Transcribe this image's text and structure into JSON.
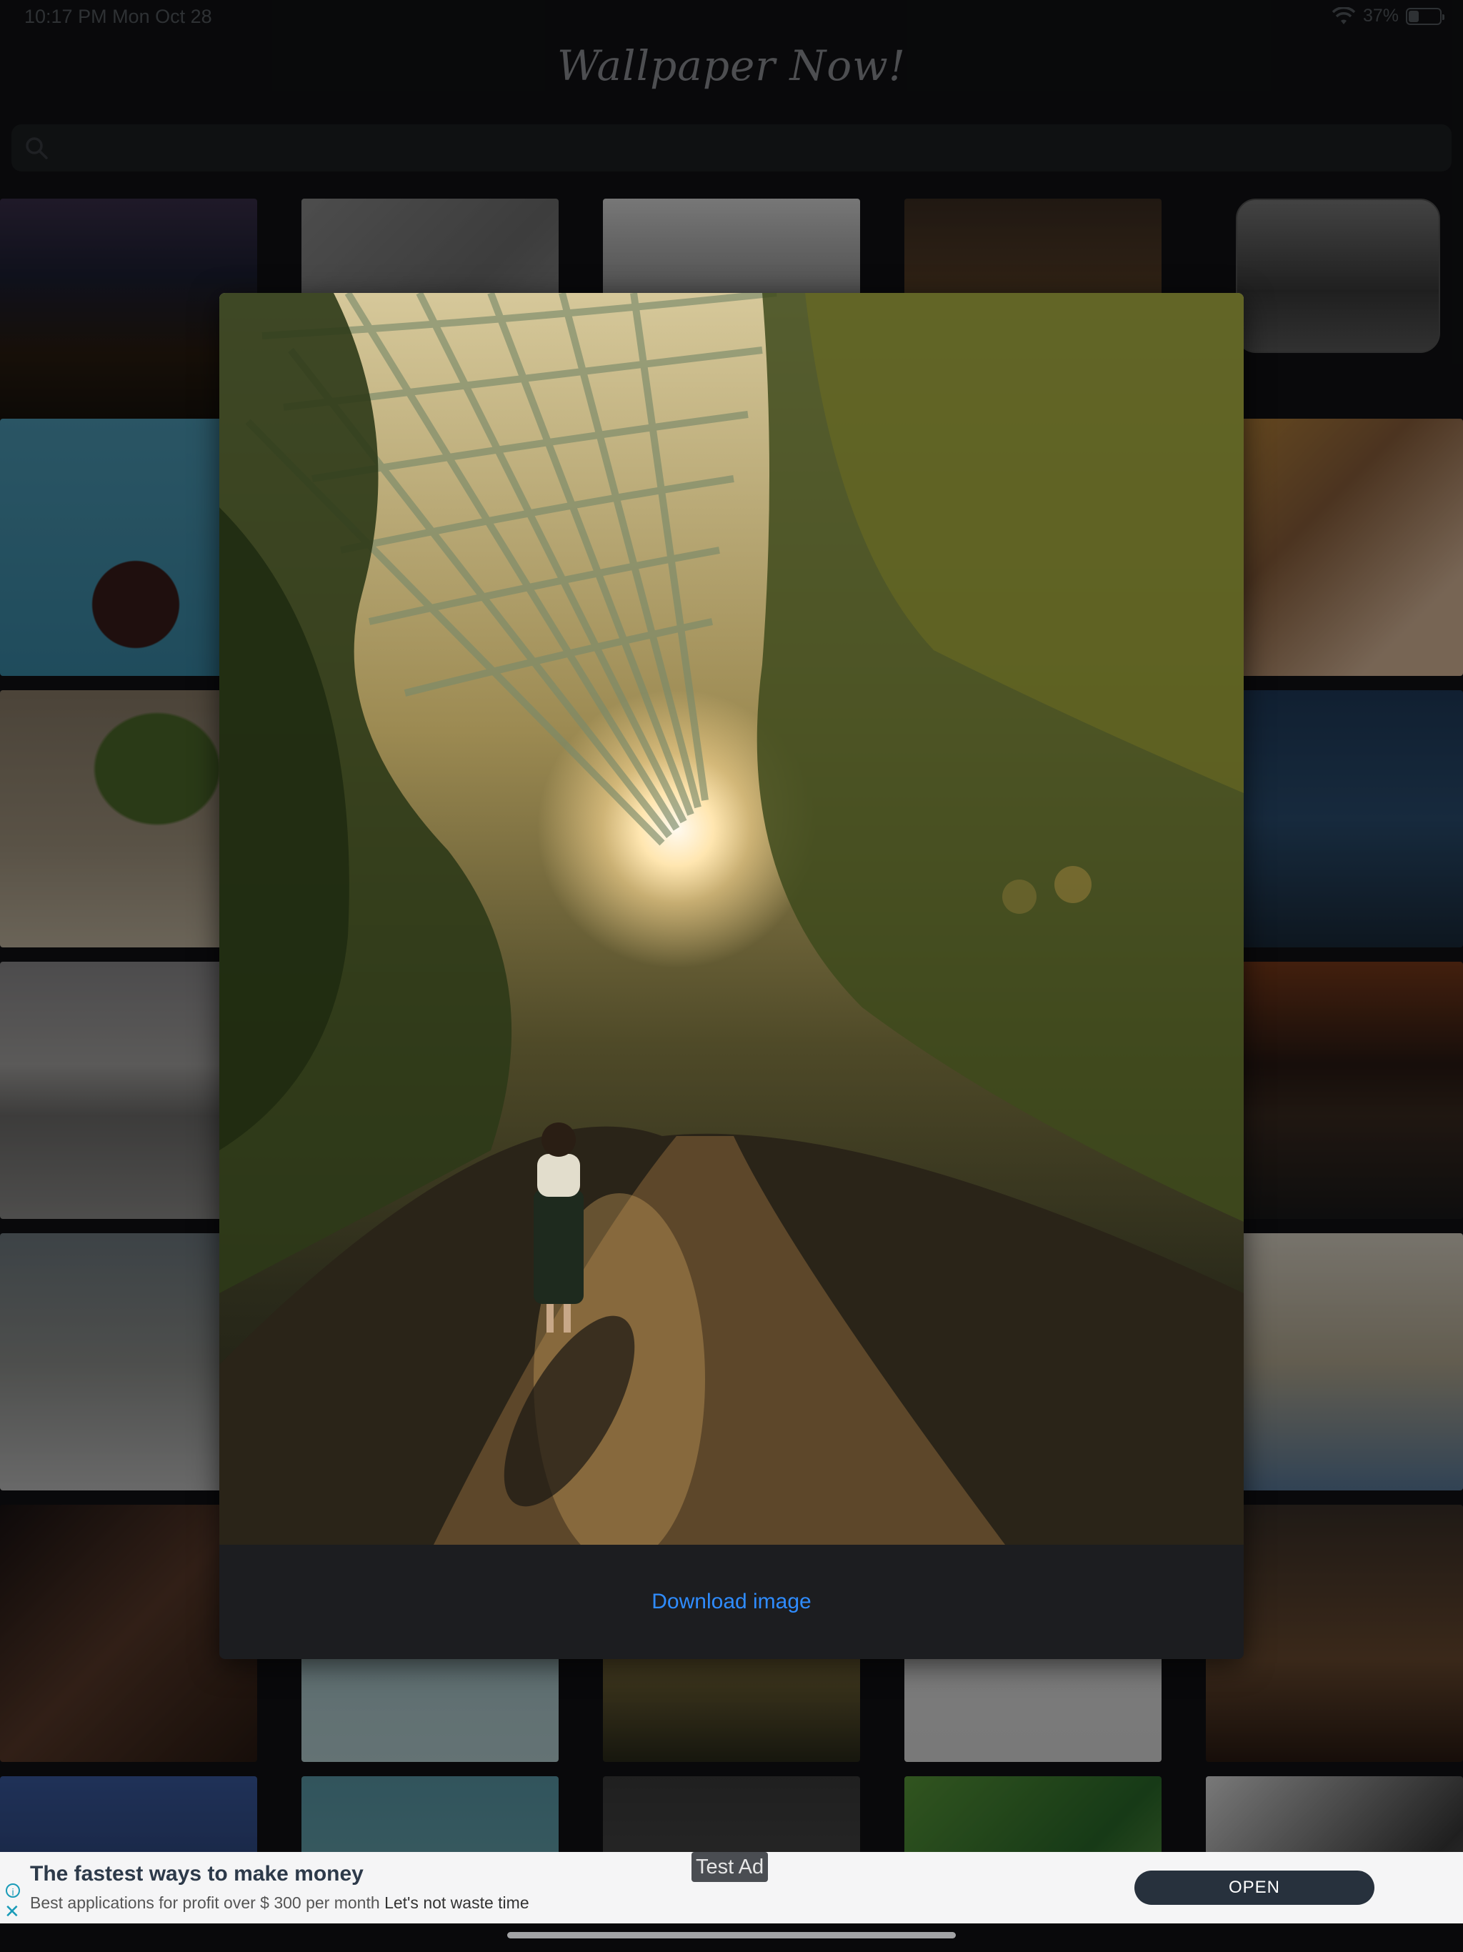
{
  "status_bar": {
    "time": "10:17 PM  Mon Oct 28",
    "battery": "37%"
  },
  "app": {
    "title": "Wallpaper Now!"
  },
  "search": {
    "placeholder": ""
  },
  "modal": {
    "download_label": "Download image"
  },
  "ad": {
    "badge": "Test Ad",
    "title": "The fastest ways to make money",
    "description": "Best applications for profit over $ 300 per month",
    "description_suffix": "Let's not waste time",
    "cta": "OPEN"
  },
  "colors": {
    "accent": "#2f8cff",
    "background": "#111214",
    "ad_button": "#27313d"
  }
}
